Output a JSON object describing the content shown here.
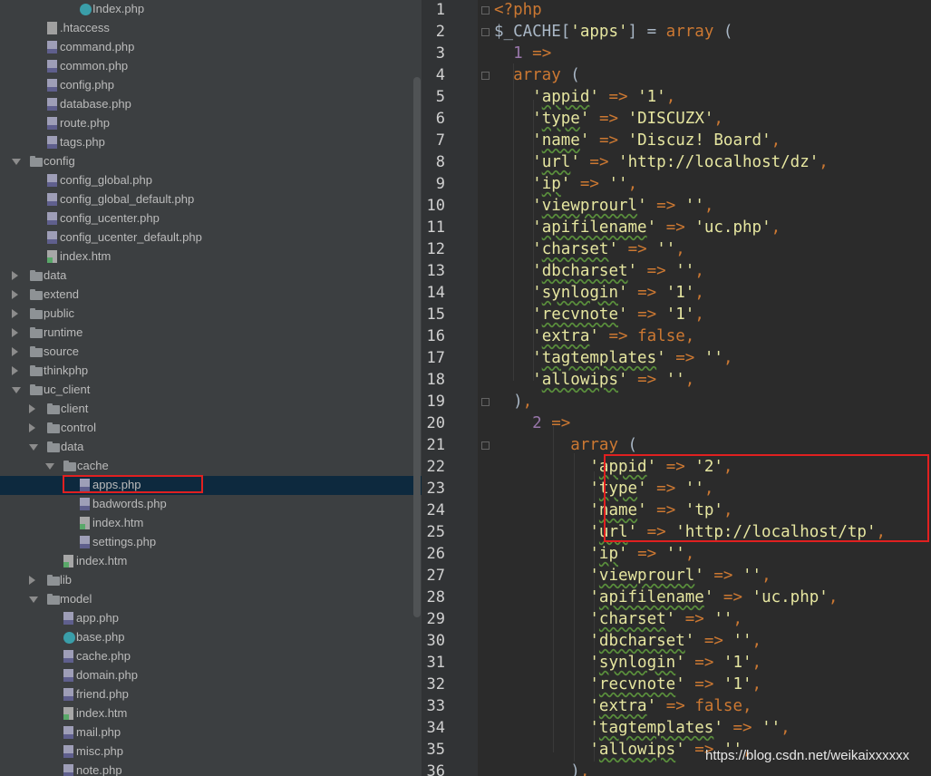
{
  "project_tree": {
    "items": [
      {
        "label": "Index.php",
        "icon": "php-class-icon",
        "expand": "none",
        "selected": false
      },
      {
        "label": ".htaccess",
        "icon": "htaccess-file-icon",
        "expand": "none",
        "selected": false
      },
      {
        "label": "command.php",
        "icon": "php-file-icon",
        "expand": "none",
        "selected": false
      },
      {
        "label": "common.php",
        "icon": "php-file-icon",
        "expand": "none",
        "selected": false
      },
      {
        "label": "config.php",
        "icon": "php-file-icon",
        "expand": "none",
        "selected": false
      },
      {
        "label": "database.php",
        "icon": "php-file-icon",
        "expand": "none",
        "selected": false
      },
      {
        "label": "route.php",
        "icon": "php-file-icon",
        "expand": "none",
        "selected": false
      },
      {
        "label": "tags.php",
        "icon": "php-file-icon",
        "expand": "none",
        "selected": false
      },
      {
        "label": "config",
        "icon": "folder-icon",
        "expand": "open",
        "selected": false
      },
      {
        "label": "config_global.php",
        "icon": "php-file-icon",
        "expand": "none",
        "selected": false
      },
      {
        "label": "config_global_default.php",
        "icon": "php-file-icon",
        "expand": "none",
        "selected": false
      },
      {
        "label": "config_ucenter.php",
        "icon": "php-file-icon",
        "expand": "none",
        "selected": false
      },
      {
        "label": "config_ucenter_default.php",
        "icon": "php-file-icon",
        "expand": "none",
        "selected": false
      },
      {
        "label": "index.htm",
        "icon": "html-file-icon",
        "expand": "none",
        "selected": false
      },
      {
        "label": "data",
        "icon": "folder-icon",
        "expand": "closed",
        "selected": false
      },
      {
        "label": "extend",
        "icon": "folder-icon",
        "expand": "closed",
        "selected": false
      },
      {
        "label": "public",
        "icon": "folder-icon",
        "expand": "closed",
        "selected": false
      },
      {
        "label": "runtime",
        "icon": "folder-icon",
        "expand": "closed",
        "selected": false
      },
      {
        "label": "source",
        "icon": "folder-icon",
        "expand": "closed",
        "selected": false
      },
      {
        "label": "thinkphp",
        "icon": "folder-icon",
        "expand": "closed",
        "selected": false
      },
      {
        "label": "uc_client",
        "icon": "folder-icon",
        "expand": "open",
        "selected": false
      },
      {
        "label": "client",
        "icon": "folder-icon",
        "expand": "closed",
        "selected": false
      },
      {
        "label": "control",
        "icon": "folder-icon",
        "expand": "closed",
        "selected": false
      },
      {
        "label": "data",
        "icon": "folder-icon",
        "expand": "open",
        "selected": false
      },
      {
        "label": "cache",
        "icon": "folder-icon",
        "expand": "open",
        "selected": false
      },
      {
        "label": "apps.php",
        "icon": "php-file-icon",
        "expand": "none",
        "selected": true
      },
      {
        "label": "badwords.php",
        "icon": "php-file-icon",
        "expand": "none",
        "selected": false
      },
      {
        "label": "index.htm",
        "icon": "html-file-icon",
        "expand": "none",
        "selected": false
      },
      {
        "label": "settings.php",
        "icon": "php-file-icon",
        "expand": "none",
        "selected": false
      },
      {
        "label": "index.htm",
        "icon": "html-file-icon",
        "expand": "none",
        "selected": false
      },
      {
        "label": "lib",
        "icon": "folder-icon",
        "expand": "closed",
        "selected": false
      },
      {
        "label": "model",
        "icon": "folder-icon",
        "expand": "open",
        "selected": false
      },
      {
        "label": "app.php",
        "icon": "php-file-icon",
        "expand": "none",
        "selected": false
      },
      {
        "label": "base.php",
        "icon": "php-class-icon",
        "expand": "none",
        "selected": false
      },
      {
        "label": "cache.php",
        "icon": "php-file-icon",
        "expand": "none",
        "selected": false
      },
      {
        "label": "domain.php",
        "icon": "php-file-icon",
        "expand": "none",
        "selected": false
      },
      {
        "label": "friend.php",
        "icon": "php-file-icon",
        "expand": "none",
        "selected": false
      },
      {
        "label": "index.htm",
        "icon": "html-file-icon",
        "expand": "none",
        "selected": false
      },
      {
        "label": "mail.php",
        "icon": "php-file-icon",
        "expand": "none",
        "selected": false
      },
      {
        "label": "misc.php",
        "icon": "php-file-icon",
        "expand": "none",
        "selected": false
      },
      {
        "label": "note.php",
        "icon": "php-file-icon",
        "expand": "none",
        "selected": false
      }
    ]
  },
  "editor": {
    "lines": [
      {
        "n": "1",
        "t": "<?php"
      },
      {
        "n": "2",
        "t": "$_CACHE['apps'] = array ("
      },
      {
        "n": "3",
        "t": "  1 =>"
      },
      {
        "n": "4",
        "t": "  array ("
      },
      {
        "n": "5",
        "t": "    'appid' => '1',"
      },
      {
        "n": "6",
        "t": "    'type' => 'DISCUZX',"
      },
      {
        "n": "7",
        "t": "    'name' => 'Discuz! Board',"
      },
      {
        "n": "8",
        "t": "    'url' => 'http://localhost/dz',"
      },
      {
        "n": "9",
        "t": "    'ip' => '',"
      },
      {
        "n": "10",
        "t": "    'viewprourl' => '',"
      },
      {
        "n": "11",
        "t": "    'apifilename' => 'uc.php',"
      },
      {
        "n": "12",
        "t": "    'charset' => '',"
      },
      {
        "n": "13",
        "t": "    'dbcharset' => '',"
      },
      {
        "n": "14",
        "t": "    'synlogin' => '1',"
      },
      {
        "n": "15",
        "t": "    'recvnote' => '1',"
      },
      {
        "n": "16",
        "t": "    'extra' => false,"
      },
      {
        "n": "17",
        "t": "    'tagtemplates' => '',"
      },
      {
        "n": "18",
        "t": "    'allowips' => '',"
      },
      {
        "n": "19",
        "t": "  ),"
      },
      {
        "n": "20",
        "t": "    2 =>"
      },
      {
        "n": "21",
        "t": "        array ("
      },
      {
        "n": "22",
        "t": "          'appid' => '2',"
      },
      {
        "n": "23",
        "t": "          'type' => '',"
      },
      {
        "n": "24",
        "t": "          'name' => 'tp',"
      },
      {
        "n": "25",
        "t": "          'url' => 'http://localhost/tp',"
      },
      {
        "n": "26",
        "t": "          'ip' => '',"
      },
      {
        "n": "27",
        "t": "          'viewprourl' => '',"
      },
      {
        "n": "28",
        "t": "          'apifilename' => 'uc.php',"
      },
      {
        "n": "29",
        "t": "          'charset' => '',"
      },
      {
        "n": "30",
        "t": "          'dbcharset' => '',"
      },
      {
        "n": "31",
        "t": "          'synlogin' => '1',"
      },
      {
        "n": "32",
        "t": "          'recvnote' => '1',"
      },
      {
        "n": "33",
        "t": "          'extra' => false,"
      },
      {
        "n": "34",
        "t": "          'tagtemplates' => '',"
      },
      {
        "n": "35",
        "t": "          'allowips' => '',"
      },
      {
        "n": "36",
        "t": "        ),"
      }
    ]
  },
  "watermark": "https://blog.csdn.net/weikaixxxxxx",
  "colors": {
    "tree_bg": "#3c3f41",
    "editor_bg": "#2b2b2b",
    "gutter_bg": "#313335",
    "keyword": "#cc7832",
    "string": "#e6e6a0",
    "number": "#9876aa",
    "highlight_box": "#e02020",
    "selection": "#0d293e"
  }
}
